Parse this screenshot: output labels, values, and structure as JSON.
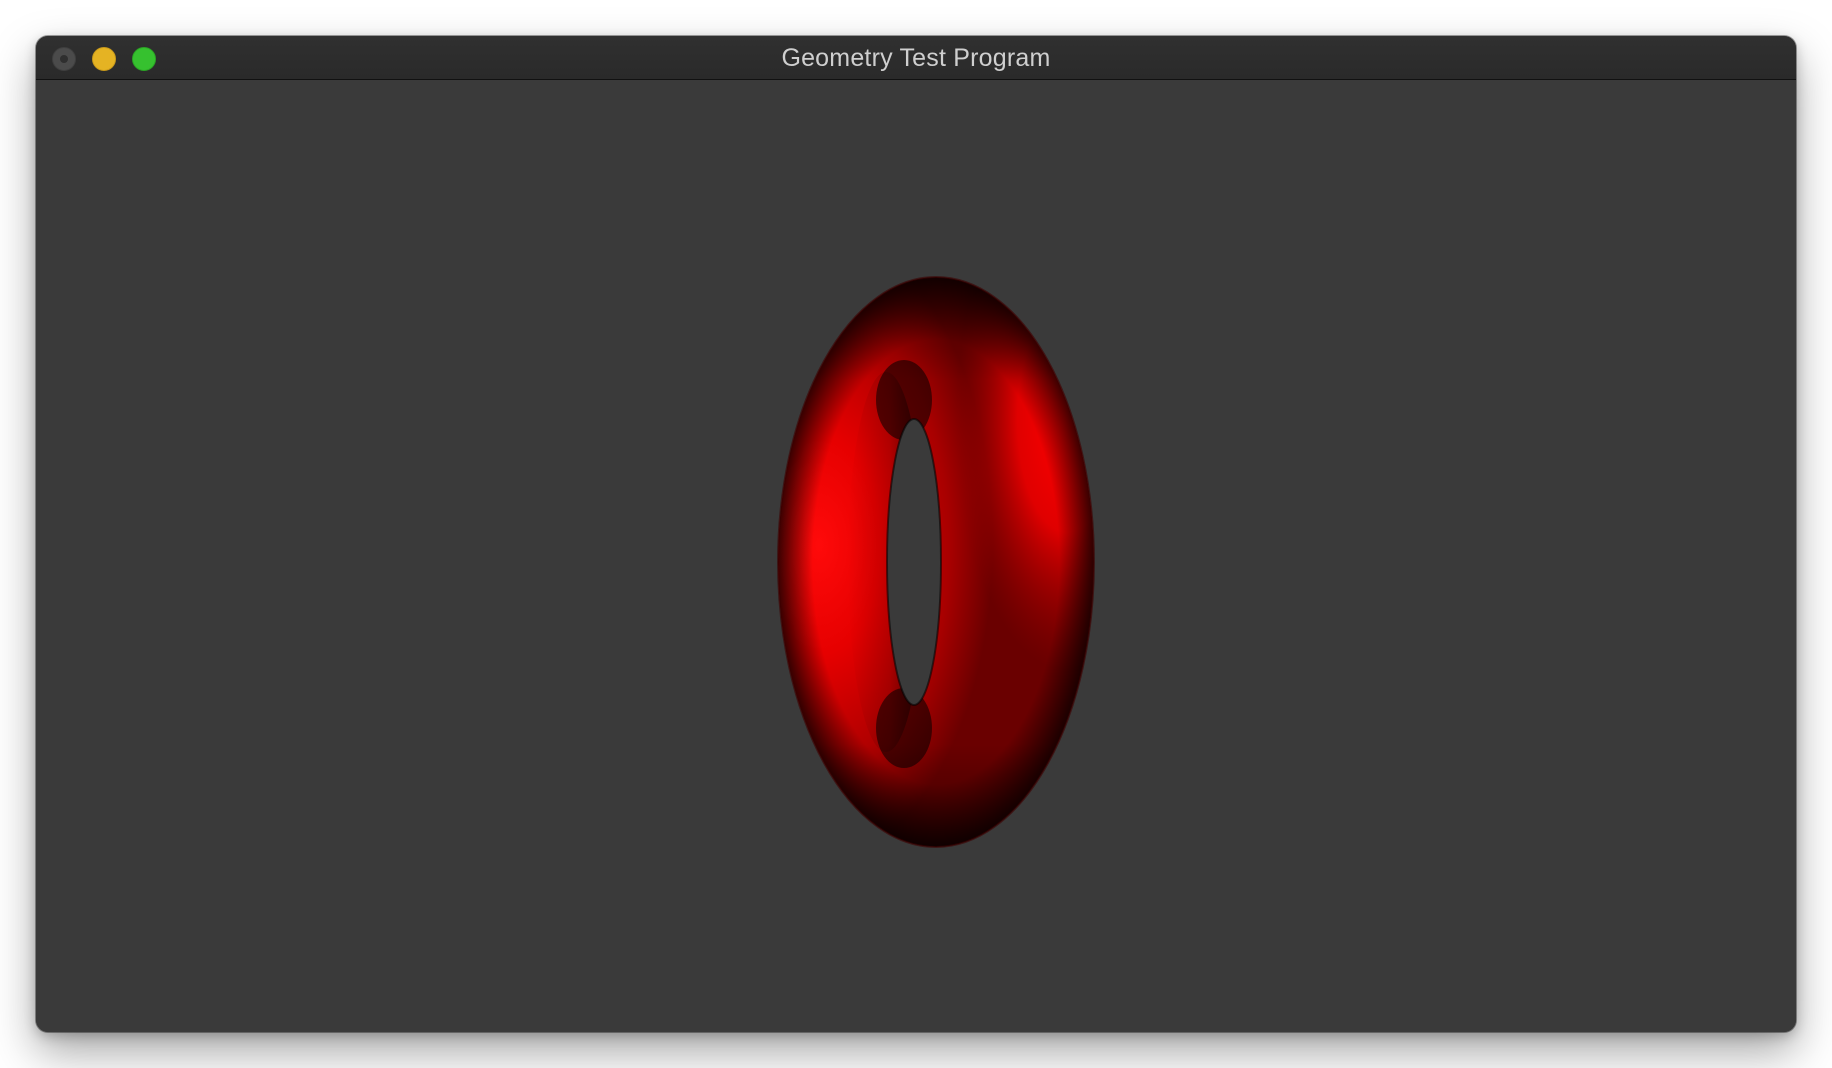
{
  "window": {
    "title": "Geometry Test Program"
  },
  "titlebar": {
    "buttons": [
      "close",
      "minimize",
      "zoom"
    ]
  },
  "scene": {
    "object": "torus",
    "object_color": "#ff0000",
    "background_color": "#3a3a3a"
  }
}
